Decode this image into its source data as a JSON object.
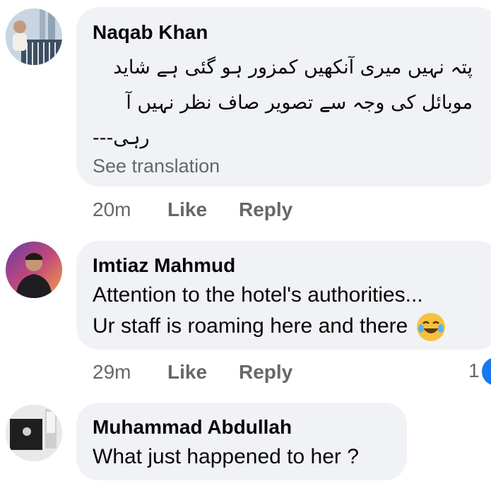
{
  "comments": [
    {
      "author": "Naqab Khan",
      "text_lines": [
        "پتہ نہیں میری آنکھیں کمزور ہو گئی ہے شاید",
        "موبائل کی وجہ سے تصویر صاف نظر نہیں آ",
        "رہی---"
      ],
      "see_translation": "See translation",
      "time": "20m",
      "like_label": "Like",
      "reply_label": "Reply"
    },
    {
      "author": "Imtiaz Mahmud",
      "text_lines": [
        "Attention to the hotel's authorities...",
        "Ur staff is roaming here and there"
      ],
      "emoji": "joy-emoji",
      "time": "29m",
      "like_label": "Like",
      "reply_label": "Reply",
      "reaction_count": "1"
    },
    {
      "author": "Muhammad Abdullah",
      "text_lines": [
        "What just happened to her ?"
      ]
    }
  ],
  "colors": {
    "bubble": "#f0f2f5",
    "meta_text": "#65676b",
    "author_text": "#050505"
  }
}
